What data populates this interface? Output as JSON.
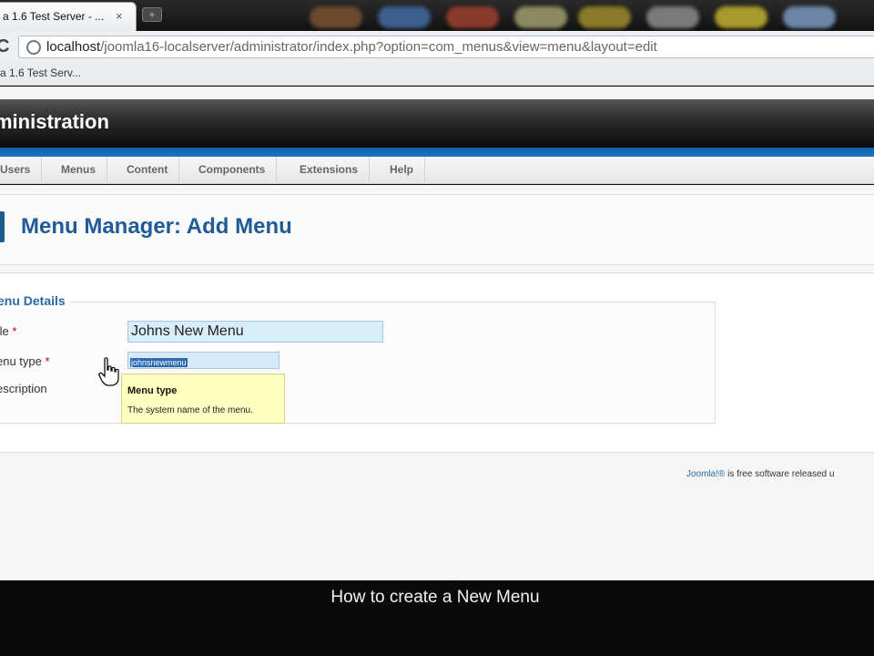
{
  "browser": {
    "tab_title": "a 1.6 Test Server - ...",
    "tab_close": "×",
    "new_tab": "+",
    "url_host": "localhost",
    "url_path": "/joomla16-localserver/administrator/index.php?option=com_menus&view=menu&layout=edit",
    "bookmark": "a 1.6 Test Serv...",
    "reload_icon": "C"
  },
  "admin": {
    "header_title": "ministration",
    "menu": [
      "Users",
      "Menus",
      "Content",
      "Components",
      "Extensions",
      "Help"
    ],
    "page_title": "Menu Manager: Add Menu"
  },
  "form": {
    "legend": "enu Details",
    "title_label": "tle",
    "title_value": "Johns New Menu",
    "menu_type_label": "enu type",
    "menu_type_value": "johnsnewmenu",
    "description_label": "escription",
    "required_mark": "*"
  },
  "tooltip": {
    "title": "Menu type",
    "text": "The system name of the menu."
  },
  "footer": {
    "link": "Joomla!®",
    "text": " is free software released u"
  },
  "caption": "How to create a New Menu",
  "colors": {
    "accent_blue": "#1f5b96",
    "header_dark": "#0d0d0d",
    "tooltip_bg": "#ffffc2"
  }
}
